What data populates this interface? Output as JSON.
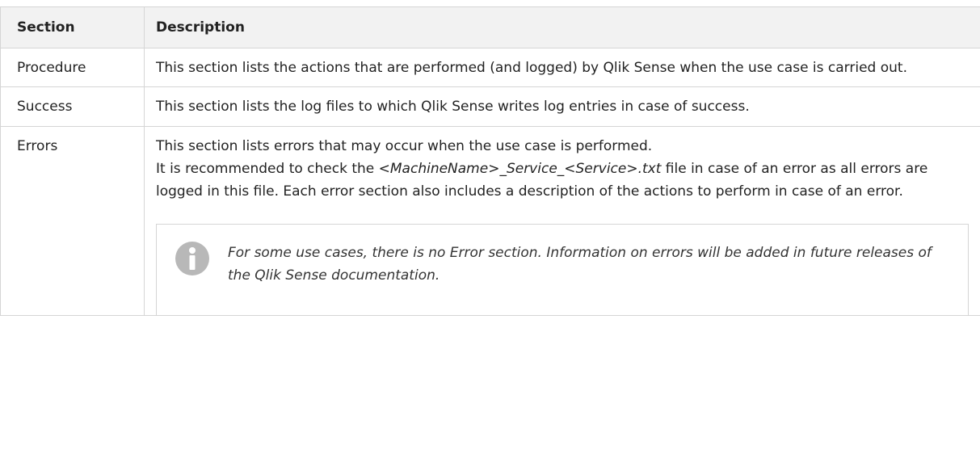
{
  "table": {
    "headers": {
      "section": "Section",
      "description": "Description"
    },
    "rows": [
      {
        "section": "Procedure",
        "description": "This section lists the actions that are performed (and logged) by Qlik Sense when the use case is carried out."
      },
      {
        "section": "Success",
        "description": "This section lists the log files to which Qlik Sense writes log entries in case of success."
      },
      {
        "section": "Errors",
        "description": "This section lists errors that may occur when the use case is performed.",
        "para_prefix": "It is recommended to check the ",
        "para_filename": "<MachineName>_Service_<Service>.txt",
        "para_suffix": " file in case of an error as all errors are logged in this file. Each error section also includes a description of the actions to perform in case of an error.",
        "note_icon": "info-icon",
        "note": "For some use cases, there is no Error section. Information on errors will be added in future releases of the Qlik Sense documentation."
      }
    ]
  },
  "colors": {
    "border": "#d5d5d5",
    "header_bg": "#f2f2f2",
    "icon": "#b8b8b8"
  }
}
